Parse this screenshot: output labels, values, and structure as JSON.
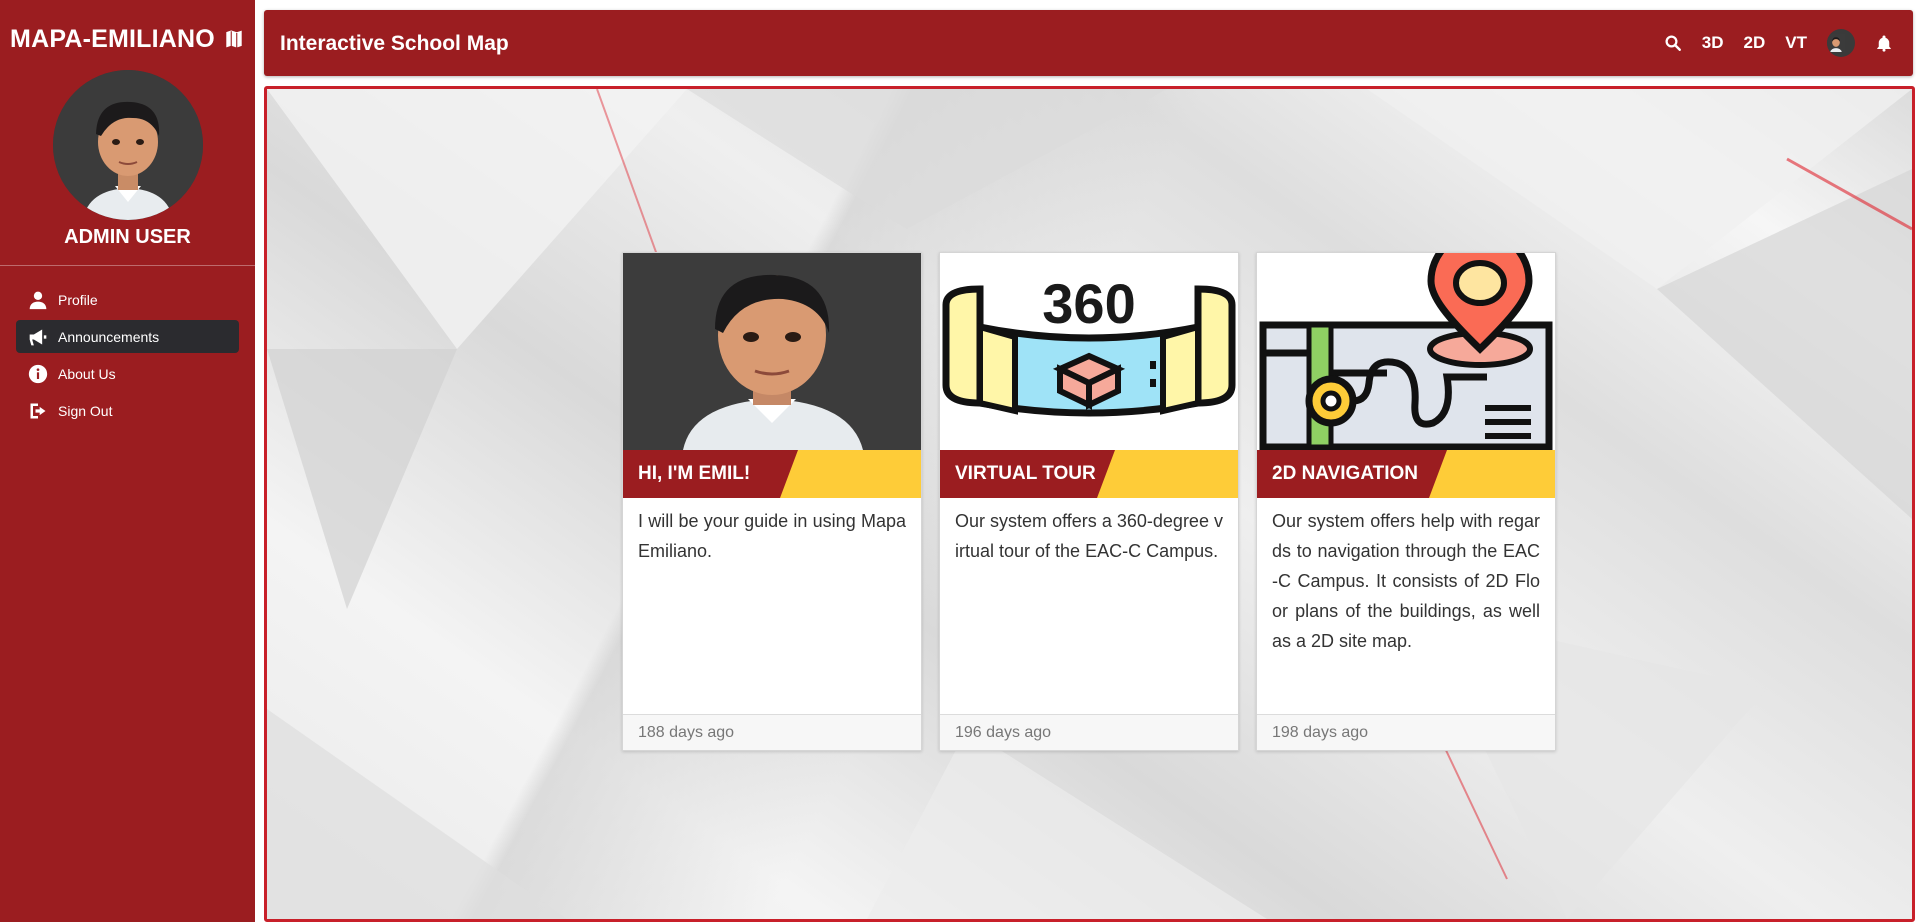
{
  "sidebar": {
    "brand": "MAPA-EMILIANO",
    "user_name": "ADMIN USER",
    "items": [
      {
        "label": "Profile",
        "icon": "user-icon"
      },
      {
        "label": "Announcements",
        "icon": "megaphone-icon"
      },
      {
        "label": "About Us",
        "icon": "info-icon"
      },
      {
        "label": "Sign Out",
        "icon": "sign-out-icon"
      }
    ],
    "active_item": "Announcements"
  },
  "header": {
    "title": "Interactive School Map",
    "tools": {
      "view_3d": "3D",
      "view_2d": "2D",
      "view_vt": "VT"
    }
  },
  "cards": [
    {
      "title": "HI, I'M EMIL!",
      "text": "I will be your guide in using Mapa Emiliano.",
      "time": "188 days ago",
      "image": "avatar-image"
    },
    {
      "title": "VIRTUAL TOUR",
      "text": "Our system offers a 360-degree virtual tour of the EAC-C Campus.",
      "time": "196 days ago",
      "image": "360-tour-image",
      "image_text": "360"
    },
    {
      "title": "2D NAVIGATION",
      "text": "Our system offers help with regards to navigation through the EAC-C Campus. It consists of 2D Floor plans of the buildings, as well as a 2D site map.",
      "time": "198 days ago",
      "image": "map-pin-image"
    }
  ],
  "colors": {
    "primary": "#9b1d20",
    "accent": "#fecc38",
    "active_nav": "#2b2b2f",
    "fab": "#b5121b"
  }
}
